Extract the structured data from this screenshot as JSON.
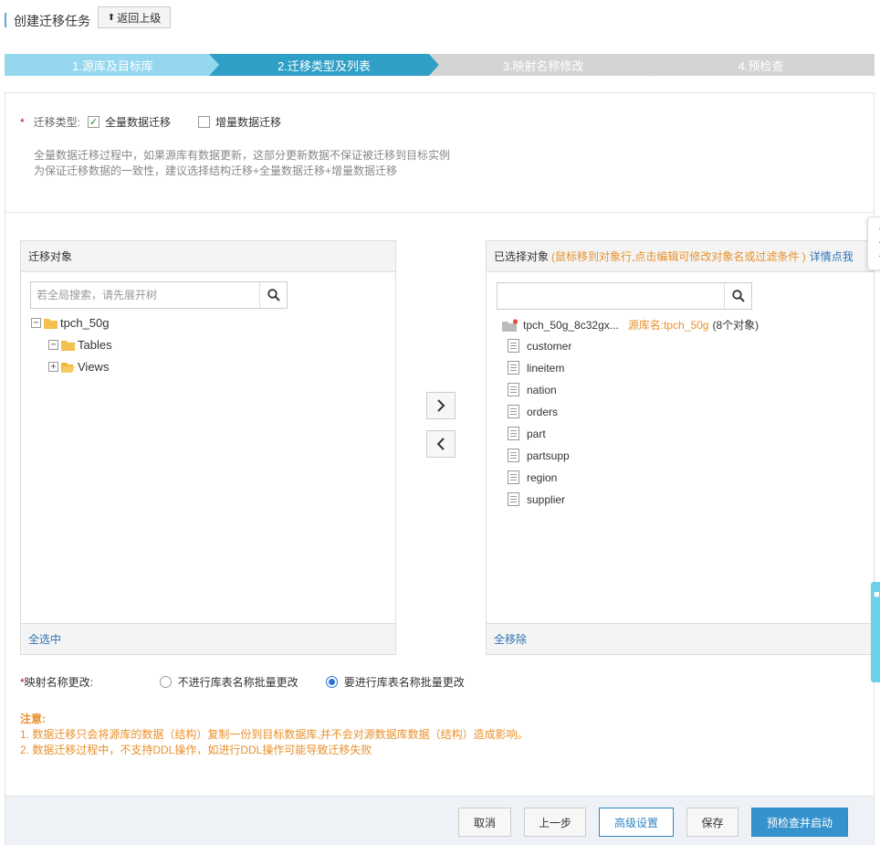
{
  "header": {
    "title": "创建迁移任务",
    "back_label": "返回上级"
  },
  "steps": [
    {
      "label": "1.源库及目标库",
      "state": "done"
    },
    {
      "label": "2.迁移类型及列表",
      "state": "active"
    },
    {
      "label": "3.映射名称修改",
      "state": "todo"
    },
    {
      "label": "4.预检查",
      "state": "todo"
    }
  ],
  "migration_type": {
    "label": "迁移类型:",
    "options": [
      {
        "label": "全量数据迁移",
        "checked": true
      },
      {
        "label": "增量数据迁移",
        "checked": false
      }
    ],
    "notes": [
      "全量数据迁移过程中，如果源库有数据更新，这部分更新数据不保证被迁移到目标实例",
      "为保证迁移数据的一致性，建议选择结构迁移+全量数据迁移+增量数据迁移"
    ]
  },
  "left_panel": {
    "title": "迁移对象",
    "search_placeholder": "若全局搜索，请先展开树",
    "tree": [
      {
        "label": "tpch_50g",
        "toggle": "−"
      },
      {
        "label": "Tables",
        "toggle": "−"
      },
      {
        "label": "Views",
        "toggle": "+"
      }
    ],
    "footer": "全选中"
  },
  "right_panel": {
    "title": "已选择对象",
    "hint": "(鼠标移到对象行,点击编辑可修改对象名或过滤条件 )",
    "link": "详情点我",
    "search_value": "",
    "db_name": "tpch_50g_8c32gx...",
    "db_source": "源库名:tpch_50g",
    "db_count": "(8个对象)",
    "items": [
      "customer",
      "lineitem",
      "nation",
      "orders",
      "part",
      "partsupp",
      "region",
      "supplier"
    ],
    "footer": "全移除"
  },
  "mapping": {
    "label": "映射名称更改:",
    "options": [
      {
        "label": "不进行库表名称批量更改",
        "selected": false
      },
      {
        "label": "要进行库表名称批量更改",
        "selected": true
      }
    ]
  },
  "warning": {
    "title": "注意:",
    "lines": [
      "1. 数据迁移只会将源库的数据（结构）复制一份到目标数据库,并不会对源数据库数据（结构）造成影响。",
      "2. 数据迁移过程中，不支持DDL操作，如进行DDL操作可能导致迁移失败"
    ]
  },
  "footer_buttons": {
    "cancel": "取消",
    "prev": "上一步",
    "advanced": "高级设置",
    "save": "保存",
    "start": "预检查并启动"
  },
  "colors": {
    "step_done": "#95d7ef",
    "step_active": "#2f9fc6",
    "step_todo": "#d4d4d4",
    "accent": "#3592cc",
    "warning": "#e8912c",
    "required": "#d9001b"
  },
  "icons": {
    "back": "up-arrow-icon",
    "search": "search-icon",
    "folder": "folder-icon",
    "table": "table-doc-icon",
    "move_right": "chevron-right-icon",
    "move_left": "chevron-left-icon"
  }
}
